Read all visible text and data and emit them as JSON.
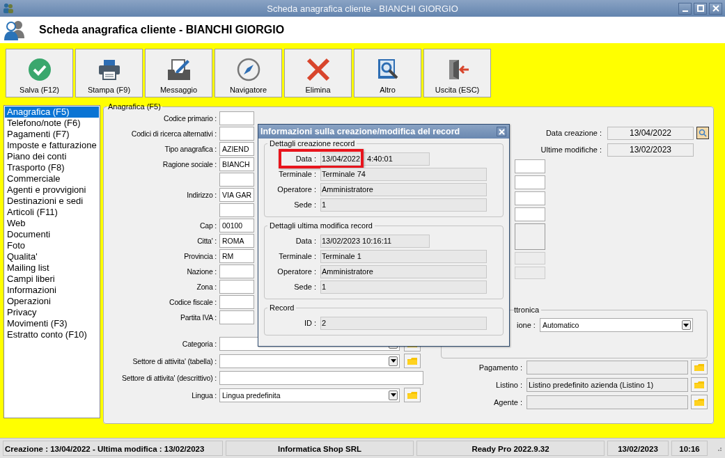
{
  "window": {
    "title": "Scheda anagrafica cliente - BIANCHI GIORGIO"
  },
  "header": {
    "title": "Scheda anagrafica cliente - BIANCHI GIORGIO"
  },
  "toolbar": [
    {
      "label": "Salva (F12)",
      "kind": "save"
    },
    {
      "label": "Stampa (F9)",
      "kind": "print"
    },
    {
      "label": "Messaggio",
      "kind": "message"
    },
    {
      "label": "Navigatore",
      "kind": "navigator"
    },
    {
      "label": "Elimina",
      "kind": "delete"
    },
    {
      "label": "Altro",
      "kind": "other"
    },
    {
      "label": "Uscita (ESC)",
      "kind": "exit"
    }
  ],
  "sidebar": {
    "items": [
      {
        "label": "Anagrafica (F5)",
        "selected": true
      },
      {
        "label": "Telefono/note (F6)",
        "selected": false
      },
      {
        "label": "Pagamenti (F7)",
        "selected": false
      },
      {
        "label": "Imposte e fatturazione",
        "selected": false
      },
      {
        "label": "Piano dei conti",
        "selected": false
      },
      {
        "label": "Trasporto (F8)",
        "selected": false
      },
      {
        "label": "Commerciale",
        "selected": false
      },
      {
        "label": "Agenti e provvigioni",
        "selected": false
      },
      {
        "label": "Destinazioni e sedi",
        "selected": false
      },
      {
        "label": "Articoli (F11)",
        "selected": false
      },
      {
        "label": "Web",
        "selected": false
      },
      {
        "label": "Documenti",
        "selected": false
      },
      {
        "label": "Foto",
        "selected": false
      },
      {
        "label": "Qualita'",
        "selected": false
      },
      {
        "label": "Mailing list",
        "selected": false
      },
      {
        "label": "Campi liberi",
        "selected": false
      },
      {
        "label": "Informazioni",
        "selected": false
      },
      {
        "label": "Operazioni",
        "selected": false
      },
      {
        "label": "Privacy",
        "selected": false
      },
      {
        "label": "Movimenti (F3)",
        "selected": false
      },
      {
        "label": "Estratto conto (F10)",
        "selected": false
      }
    ]
  },
  "form": {
    "legend": "Anagrafica (F5)",
    "main_fields": [
      {
        "kind": "labeled",
        "label": "Codice primario :"
      },
      {
        "kind": "labeled",
        "label": "Codici di ricerca alternativi :"
      },
      {
        "kind": "labeled",
        "label": "Tipo anagrafica :",
        "value": "AZIEND"
      },
      {
        "kind": "labeled",
        "label": "Ragione sociale :",
        "value": "BIANCH"
      },
      {
        "kind": "continuation"
      },
      {
        "kind": "labeled",
        "label": "Indirizzo :",
        "value": "VIA GAR"
      },
      {
        "kind": "continuation"
      },
      {
        "kind": "labeled",
        "label": "Cap :",
        "value": "00100"
      },
      {
        "kind": "labeled",
        "label": "Citta' :",
        "value": "ROMA"
      },
      {
        "kind": "labeled",
        "label": "Provincia :",
        "value": "RM"
      },
      {
        "kind": "labeled",
        "label": "Nazione :"
      },
      {
        "kind": "labeled",
        "label": "Zona :"
      },
      {
        "kind": "labeled",
        "label": "Codice fiscale :"
      },
      {
        "kind": "labeled",
        "label": "Partita IVA :"
      }
    ],
    "classification_fields": [
      {
        "label": "Categoria :",
        "kind": "combo"
      },
      {
        "label": "Settore di attivita' (tabella) :",
        "kind": "combo"
      },
      {
        "label": "Settore di attivita' (descrittivo) :",
        "kind": "text"
      },
      {
        "label": "Lingua :",
        "kind": "combo",
        "value": "Lingua predefinita"
      }
    ],
    "dates": [
      {
        "label": "Data creazione :",
        "value": "13/04/2022",
        "kind": "lookup"
      },
      {
        "label": "Ultime modifiche :",
        "value": "13/02/2023",
        "kind": "plain"
      }
    ],
    "e_invoice": {
      "legend": "ttronica",
      "field_label": "ione :",
      "value": "Automatico"
    },
    "commercial_fields": [
      {
        "label": "Pagamento :"
      },
      {
        "label": "Listino :",
        "value": "Listino predefinito azienda (Listino 1)"
      },
      {
        "label": "Agente :"
      }
    ]
  },
  "dialog": {
    "title": "Informazioni sulla creazione/modifica del record",
    "groups": [
      {
        "legend": "Dettagli creazione record",
        "rows": [
          {
            "label": "Data :",
            "value": "13/04/2022",
            "value_tail": "4:40:01",
            "kind": "date",
            "highlighted": true
          },
          {
            "label": "Terminale :",
            "value": "Terminale 74",
            "kind": "text"
          },
          {
            "label": "Operatore :",
            "value": "Amministratore",
            "kind": "text"
          },
          {
            "label": "Sede :",
            "value": "1",
            "kind": "text"
          }
        ]
      },
      {
        "legend": "Dettagli ultima modifica record",
        "rows": [
          {
            "label": "Data :",
            "value": "13/02/2023 10:16:11",
            "kind": "date"
          },
          {
            "label": "Terminale :",
            "value": "Terminale 1",
            "kind": "text"
          },
          {
            "label": "Operatore :",
            "value": "Amministratore",
            "kind": "text"
          },
          {
            "label": "Sede :",
            "value": "1",
            "kind": "text"
          }
        ]
      },
      {
        "legend": "Record",
        "rows": [
          {
            "label": "ID :",
            "value": "2",
            "kind": "text"
          }
        ]
      }
    ]
  },
  "status_bar": [
    "Creazione : 13/04/2022 - Ultima modifica : 13/02/2023",
    "Informatica Shop SRL",
    "Ready Pro 2022.9.32",
    "13/02/2023",
    "10:16"
  ]
}
